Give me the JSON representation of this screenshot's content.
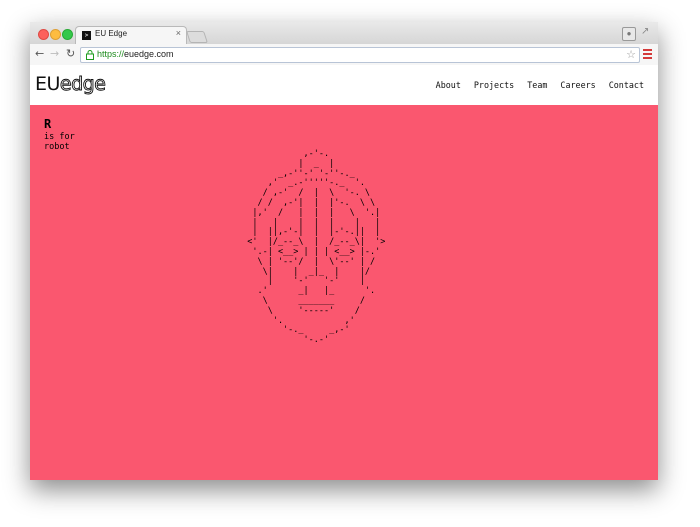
{
  "browser": {
    "tab_title": "EU Edge",
    "tab_close": "×",
    "url_scheme": "https://",
    "url_host": "euedge.com",
    "back": "←",
    "forward": "→",
    "reload": "↻",
    "star": "☆",
    "lock": "🔒"
  },
  "site": {
    "logo_primary": "EU",
    "logo_secondary": "edge",
    "nav": [
      "About",
      "Projects",
      "Team",
      "Careers",
      "Contact"
    ]
  },
  "hero": {
    "letter": "R",
    "caption_line1": "is for",
    "caption_line2": "robot",
    "background_color": "#fa576f",
    "ascii_art": "             ,-'-.\n            |  _  |\n        _,-''-' '-''-._\n      ,'  _.-'''''-._  '.\n     / ,-'  /  |  \\  '-. \\\n    / /  ,-'|  |  |'-.  \\ \\\n   |,'  /   |  |  |   \\  '.|\n   |   |    |  |  |    |   |\n   |  ||,-'-|  |  |-'-.||  |\n  <'  |/_--_\\  |  /_--_\\|  '>\n   '.-| <__> | | | <__> |-.'\n    \\ | '--'/  |  \\'--' | /\n     \\|    |  _|_  |    |/\n      |    '-'   '-'    |\n    .'      _|   |_      '.\n     \\      _______     /\n      \\     '-----'    /\n       '.            ,'\n         '-._     _,-'\n             '-.-'"
  }
}
